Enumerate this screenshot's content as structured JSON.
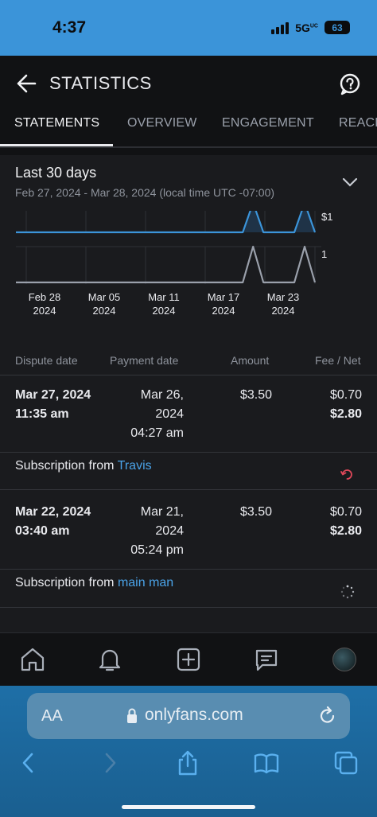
{
  "status": {
    "time": "4:37",
    "network": "5G",
    "network_sup": "UC",
    "battery": "63"
  },
  "header": {
    "title": "STATISTICS"
  },
  "tabs": [
    "STATEMENTS",
    "OVERVIEW",
    "ENGAGEMENT",
    "REACH"
  ],
  "period": {
    "title": "Last 30 days",
    "range": "Feb 27, 2024 - Mar 28, 2024 (local time UTC -07:00)"
  },
  "chart_data": {
    "type": "line",
    "x_ticks": [
      {
        "line1": "Feb 28",
        "line2": "2024"
      },
      {
        "line1": "Mar 05",
        "line2": "2024"
      },
      {
        "line1": "Mar 11",
        "line2": "2024"
      },
      {
        "line1": "Mar 17",
        "line2": "2024"
      },
      {
        "line1": "Mar 23",
        "line2": "2024"
      }
    ],
    "series": [
      {
        "values": [
          0,
          0,
          0,
          0,
          0,
          0,
          0,
          0,
          0,
          0,
          0,
          0,
          0,
          0,
          0,
          0,
          0,
          0,
          0,
          0,
          0,
          0,
          0,
          3.5,
          0,
          0,
          0,
          0,
          3.5,
          0
        ],
        "y_label": "$1",
        "color": "#3b94d9"
      },
      {
        "values": [
          0,
          0,
          0,
          0,
          0,
          0,
          0,
          0,
          0,
          0,
          0,
          0,
          0,
          0,
          0,
          0,
          0,
          0,
          0,
          0,
          0,
          0,
          0,
          1,
          0,
          0,
          0,
          0,
          1,
          0
        ],
        "y_label": "1",
        "color": "#9aa0ab"
      }
    ]
  },
  "table": {
    "headers": {
      "dispute": "Dispute date",
      "payment": "Payment date",
      "amount": "Amount",
      "fee": "Fee / Net"
    },
    "rows": [
      {
        "dispute_line1": "Mar 27, 2024",
        "dispute_line2": "11:35 am",
        "payment_line1": "Mar 26,",
        "payment_line2": "2024",
        "payment_line3": "04:27 am",
        "amount": "$3.50",
        "fee": "$0.70",
        "net": "$2.80",
        "desc": "Subscription from",
        "user": "Travis",
        "status_icon": "undo-icon"
      },
      {
        "dispute_line1": "Mar 22, 2024",
        "dispute_line2": "03:40 am",
        "payment_line1": "Mar 21,",
        "payment_line2": "2024",
        "payment_line3": "05:24 pm",
        "amount": "$3.50",
        "fee": "$0.70",
        "net": "$2.80",
        "desc": "Subscription from",
        "user": "main man",
        "status_icon": "loading-icon"
      }
    ]
  },
  "browser": {
    "aa": "AA",
    "url": "onlyfans.com"
  }
}
